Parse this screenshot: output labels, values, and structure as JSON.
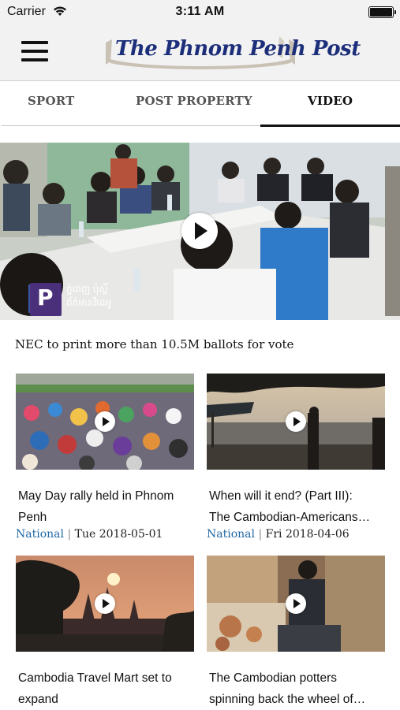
{
  "status": {
    "carrier": "Carrier",
    "time": "3:11 AM"
  },
  "header": {
    "logo_text": "The Phnom Penh Post"
  },
  "tabs": [
    {
      "label": "SPORT"
    },
    {
      "label": "POST PROPERTY"
    },
    {
      "label": "VIDEO",
      "active": true
    }
  ],
  "hero": {
    "title": "NEC to print more than 10.5M ballots for vote",
    "watermark": "ភ្នំពេញ ប៉ុស្តិ៍ ព័ត៌មានវីដេអូ"
  },
  "cards": [
    {
      "title_line1": "May Day rally held in Phnom",
      "title_line2": "Penh",
      "category": "National",
      "separator": "|",
      "date": "Tue 2018-05-01"
    },
    {
      "title_line1": "When will it end? (Part III):",
      "title_line2": "The Cambodian-Americans…",
      "category": "National",
      "separator": "|",
      "date": "Fri 2018-04-06"
    },
    {
      "title_line1": "Cambodia Travel Mart set to",
      "title_line2": "expand"
    },
    {
      "title_line1": "The Cambodian potters",
      "title_line2": "spinning back the wheel of…"
    }
  ],
  "colors": {
    "logo": "#1d2f7a",
    "category_link": "#2068a6",
    "navbar_bg": "#f2f2f2"
  }
}
